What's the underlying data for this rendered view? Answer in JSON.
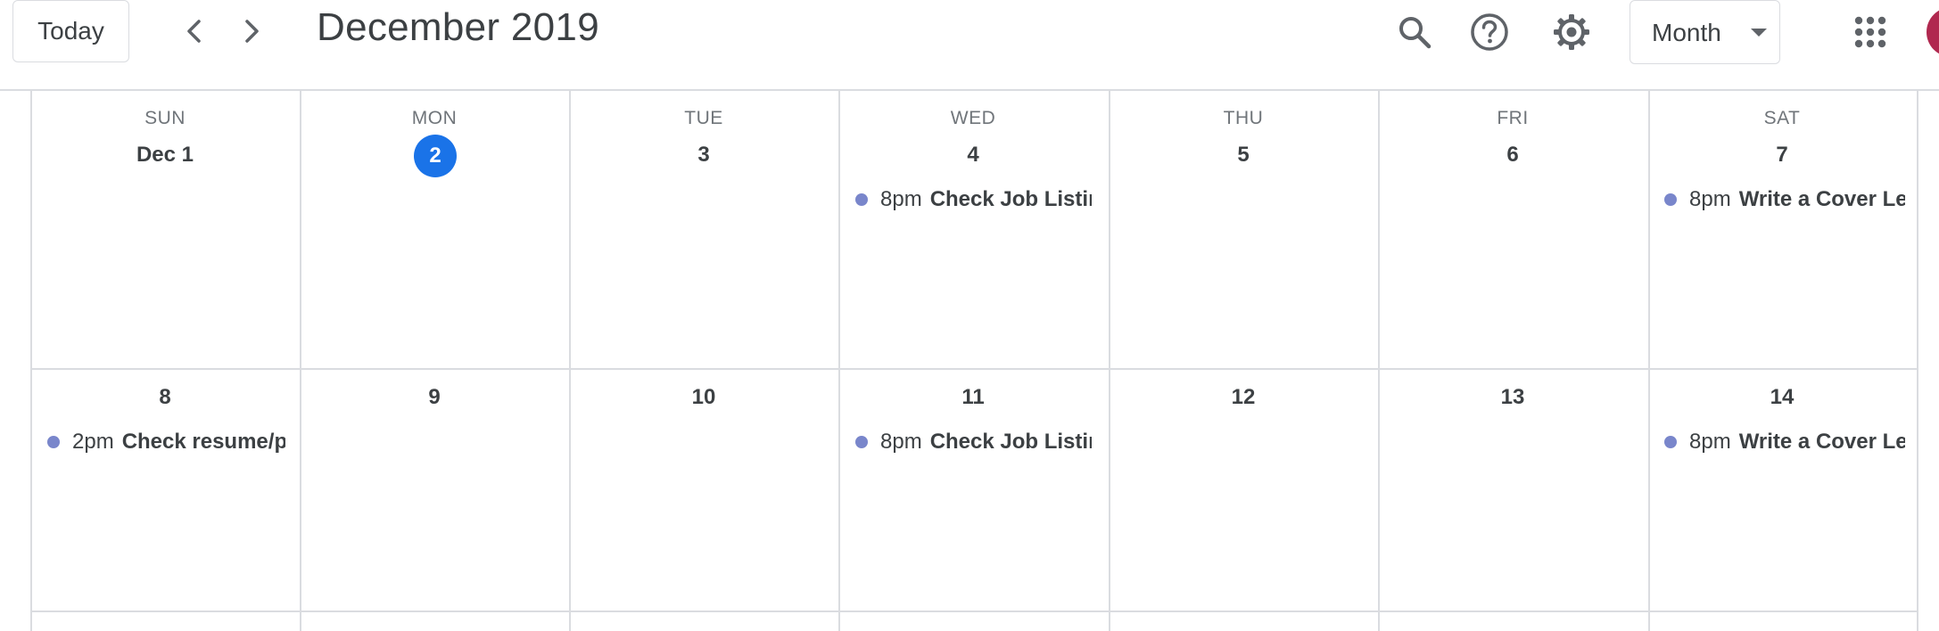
{
  "header": {
    "today_label": "Today",
    "title": "December 2019",
    "view_label": "Month",
    "icons": [
      "chevron-left-icon",
      "chevron-right-icon",
      "search-icon",
      "help-icon",
      "gear-icon",
      "apps-grid-icon",
      "avatar"
    ],
    "avatar_color": "#b0284f"
  },
  "calendar": {
    "weekdays": [
      "SUN",
      "MON",
      "TUE",
      "WED",
      "THU",
      "FRI",
      "SAT"
    ],
    "week1": [
      "Dec 1",
      "2",
      "3",
      "4",
      "5",
      "6",
      "7"
    ],
    "week2": [
      "8",
      "9",
      "10",
      "11",
      "12",
      "13",
      "14"
    ],
    "today": "2",
    "today_color": "#1a73e8",
    "event_dot_color": "#7986cb",
    "events": [
      {
        "day": "4",
        "time": "8pm",
        "title": "Check Job Listings"
      },
      {
        "day": "7",
        "time": "8pm",
        "title": "Write a Cover Letter"
      },
      {
        "day": "8",
        "time": "2pm",
        "title": "Check resume/portfolio"
      },
      {
        "day": "11",
        "time": "8pm",
        "title": "Check Job Listings"
      },
      {
        "day": "14",
        "time": "8pm",
        "title": "Write a Cover Letter"
      }
    ]
  }
}
